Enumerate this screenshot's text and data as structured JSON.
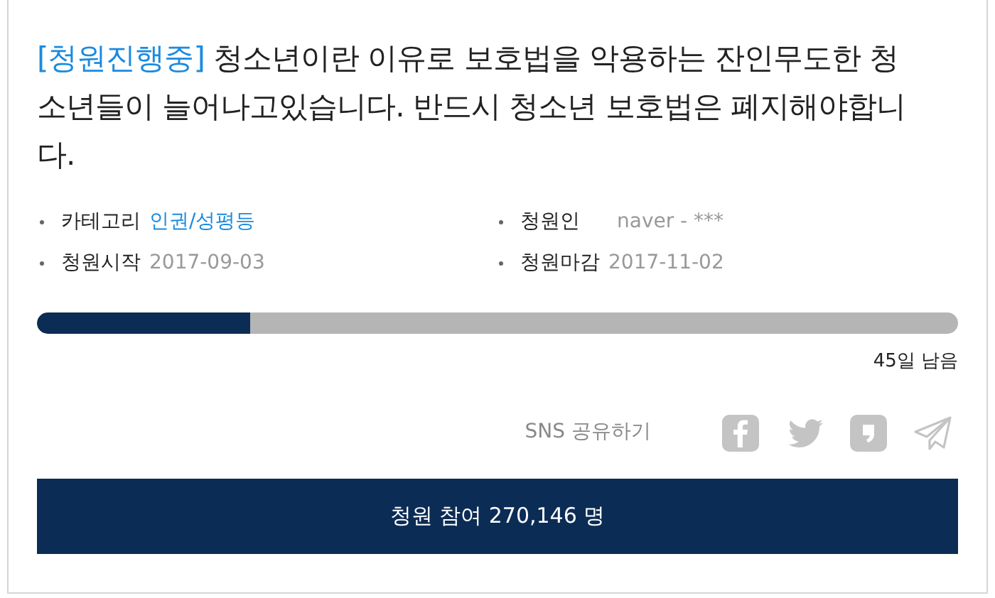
{
  "petition": {
    "status": "[청원진행중]",
    "title": "청소년이란 이유로 보호법을 악용하는 잔인무도한 청소년들이 늘어나고있습니다. 반드시 청소년 보호법은 폐지해야합니다."
  },
  "meta": [
    {
      "label": "카테고리",
      "value": "인권/성평등",
      "kind": "link"
    },
    {
      "label": "청원인",
      "value": "naver - ***",
      "kind": "plain"
    },
    {
      "label": "청원시작",
      "value": "2017-09-03",
      "kind": "plain"
    },
    {
      "label": "청원마감",
      "value": "2017-11-02",
      "kind": "plain"
    }
  ],
  "progress": {
    "level": 0.232,
    "remaining": "45일 남음"
  },
  "share": {
    "label": "SNS 공유하기"
  },
  "join_button": "청원 참여 270,146 명"
}
